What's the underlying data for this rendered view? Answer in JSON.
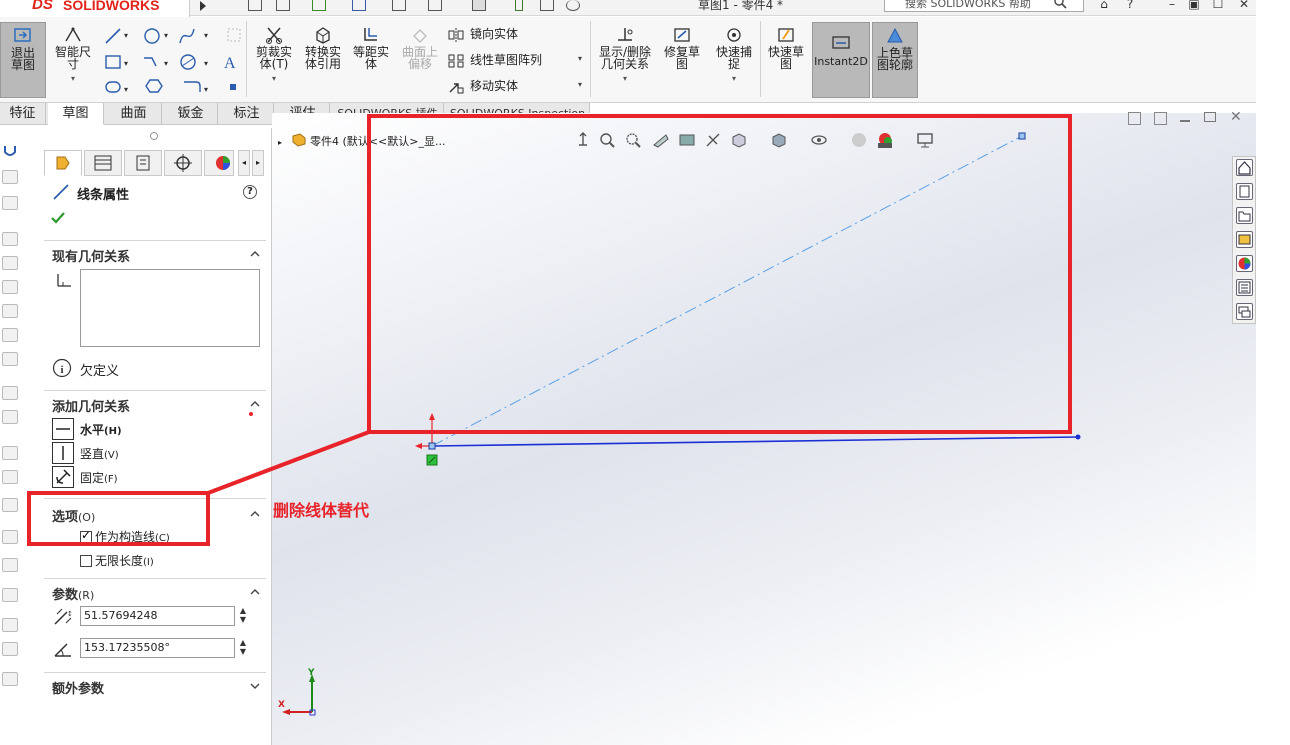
{
  "titlebar": {
    "logo_ds": "DS",
    "logo_sw": "SOLIDWORKS",
    "doc_title": "草图1 - 零件4 *",
    "search_placeholder": "搜索 SOLIDWORKS 帮助",
    "help": "?"
  },
  "commands": {
    "exit_sketch": "退出草图",
    "smart_dim": "智能尺寸",
    "trim": "剪裁实体(T)",
    "convert": "转换实体引用",
    "offset": "等距实体",
    "surface_offset": "曲面上偏移",
    "mirror": "镜向实体",
    "linear_pattern": "线性草图阵列",
    "move": "移动实体",
    "show_relations": "显示/删除几何关系",
    "repair": "修复草图",
    "quick_snap": "快速捕捉",
    "rapid_sketch": "快速草图",
    "instant2d": "Instant2D",
    "shaded_contours": "上色草图轮廓"
  },
  "tabs": [
    "特征",
    "草图",
    "曲面",
    "钣金",
    "标注",
    "评估",
    "SOLIDWORKS 插件",
    "SOLIDWORKS Inspection"
  ],
  "property_manager": {
    "title": "线条属性",
    "help": "?",
    "existing_relations": {
      "title": "现有几何关系",
      "status": "欠定义"
    },
    "add_relations": {
      "title": "添加几何关系",
      "items": [
        {
          "label": "水平",
          "key": "(H)"
        },
        {
          "label": "竖直",
          "key": "(V)"
        },
        {
          "label": "固定",
          "key": "(F)"
        }
      ]
    },
    "options": {
      "title": "选项",
      "key": "(O)",
      "construction": {
        "label": "作为构造线",
        "key": "(C)",
        "checked": true
      },
      "infinite": {
        "label": "无限长度",
        "key": "(I)",
        "checked": false
      }
    },
    "parameters": {
      "title": "参数",
      "key": "(R)",
      "length": "51.57694248",
      "angle": "153.17235508°"
    },
    "extra": {
      "title": "额外参数"
    }
  },
  "viewport": {
    "tree_item": "零件4 (默认<<默认>_显...",
    "axis_x": "X",
    "axis_y": "Y"
  },
  "annotation": {
    "callout": "删除线体替代",
    "color": "#e8232a"
  },
  "colors": {
    "construction_line": "#4a90e2",
    "solid_line": "#1a2fd6",
    "accent": "#e8232a"
  }
}
